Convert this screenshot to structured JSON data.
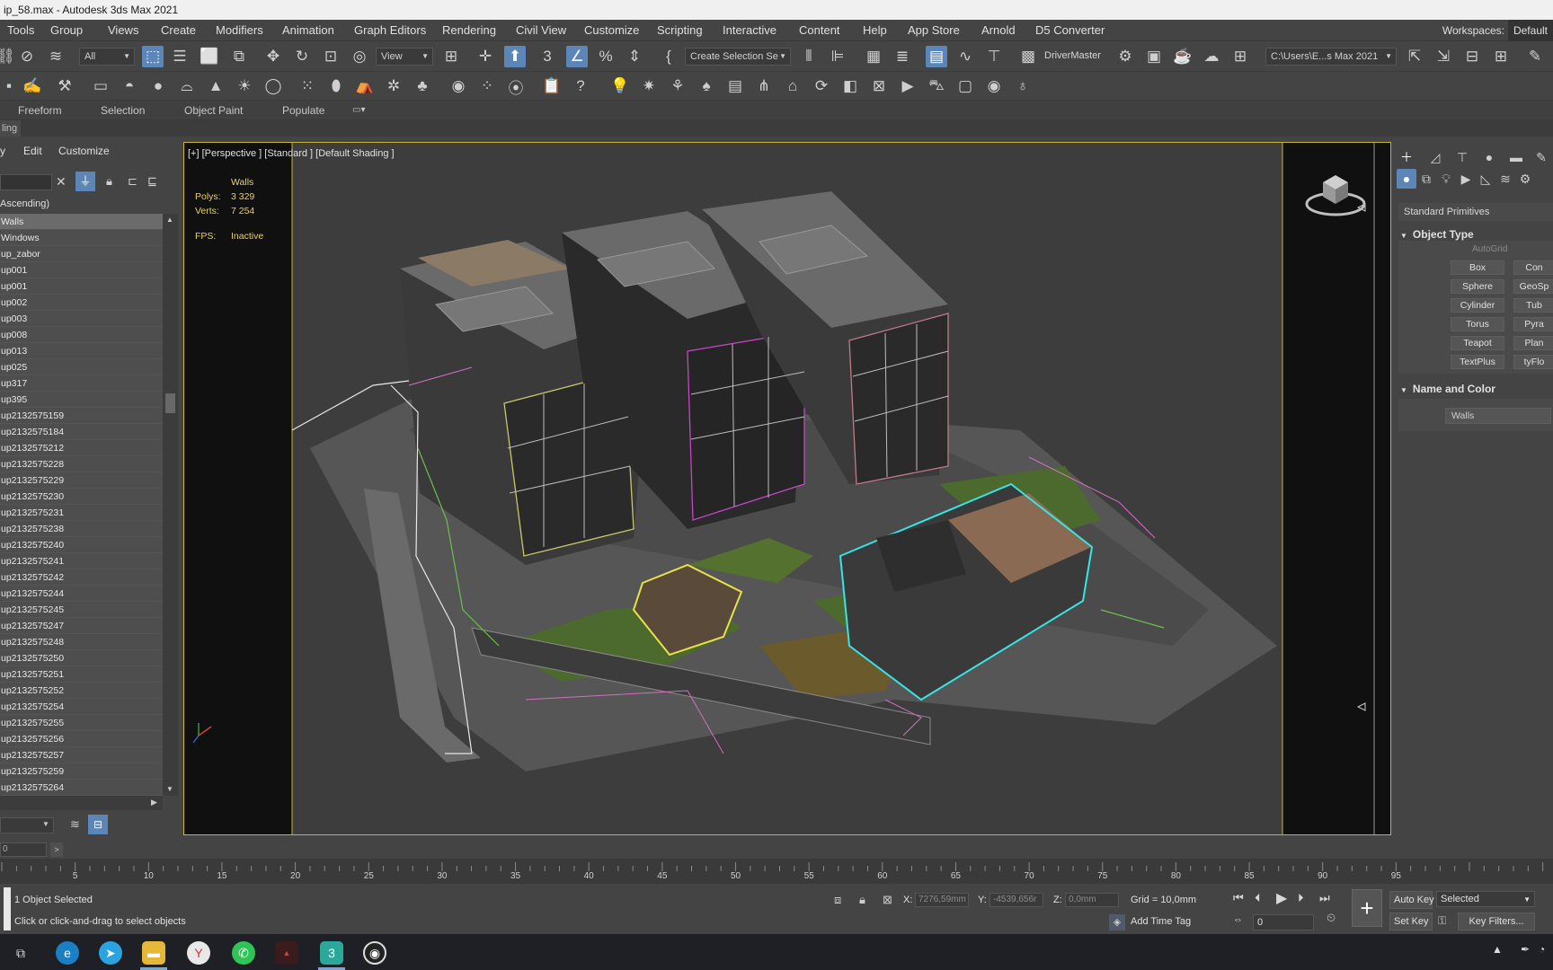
{
  "window": {
    "title": "ip_58.max - Autodesk 3ds Max 2021"
  },
  "menubar": {
    "items": [
      "Tools",
      "Group",
      "Views",
      "Create",
      "Modifiers",
      "Animation",
      "Graph Editors",
      "Rendering",
      "Civil View",
      "Customize",
      "Scripting",
      "Interactive",
      "Content",
      "Help",
      "App Store",
      "Arnold",
      "D5 Converter"
    ],
    "workspaces_label": "Workspaces:",
    "workspaces_value": "Default"
  },
  "toolbar": {
    "filter_value": "All",
    "refcoord_value": "View",
    "named_selection_value": "Create Selection Se",
    "plugin_label": "DriverMaster",
    "project_path": "C:\\Users\\E...s Max 2021"
  },
  "ribbon": {
    "tabs": [
      "Freeform",
      "Selection",
      "Object Paint",
      "Populate"
    ],
    "subtab": "ling"
  },
  "explorer": {
    "menu": [
      "y",
      "Edit",
      "Customize"
    ],
    "sort_label": "Ascending)",
    "rows": [
      "Walls",
      "Windows",
      "up_zabor",
      "up001",
      "up001",
      "up002",
      "up003",
      "up008",
      "up013",
      "up025",
      "up317",
      "up395",
      "up2132575159",
      "up2132575184",
      "up2132575212",
      "up2132575228",
      "up2132575229",
      "up2132575230",
      "up2132575231",
      "up2132575238",
      "up2132575240",
      "up2132575241",
      "up2132575242",
      "up2132575244",
      "up2132575245",
      "up2132575247",
      "up2132575248",
      "up2132575250",
      "up2132575251",
      "up2132575252",
      "up2132575254",
      "up2132575255",
      "up2132575256",
      "up2132575257",
      "up2132575259",
      "up2132575264"
    ],
    "selected_index": 0,
    "bottom_value": "0"
  },
  "viewport": {
    "label": "[+] [Perspective ] [Standard ] [Default Shading ]",
    "selected_name": "Walls",
    "polys_label": "Polys:",
    "polys_value": "3 329",
    "verts_label": "Verts:",
    "verts_value": "7 254",
    "fps_label": "FPS:",
    "fps_value": "Inactive"
  },
  "command_panel": {
    "category": "Standard Primitives",
    "object_type_title": "Object Type",
    "autogrid": "AutoGrid",
    "primitives_left": [
      "Box",
      "Sphere",
      "Cylinder",
      "Torus",
      "Teapot",
      "TextPlus"
    ],
    "primitives_right": [
      "Con",
      "GeoSp",
      "Tub",
      "Pyra",
      "Plan",
      "tyFlo"
    ],
    "name_color_title": "Name and Color",
    "name_value": "Walls"
  },
  "timeline": {
    "ticks": [
      "5",
      "10",
      "15",
      "20",
      "25",
      "30",
      "35",
      "40",
      "45",
      "50",
      "55",
      "60",
      "65",
      "70",
      "75",
      "80",
      "85",
      "90",
      "95"
    ]
  },
  "statusbar": {
    "selection_status": "1 Object Selected",
    "prompt": "Click or click-and-drag to select objects",
    "x_label": "X:",
    "x_value": "7276,59mm",
    "y_label": "Y:",
    "y_value": "-4539,656r",
    "z_label": "Z:",
    "z_value": "0,0mm",
    "grid": "Grid = 10,0mm",
    "add_time_tag": "Add Time Tag",
    "frame_value": "0",
    "auto_key": "Auto Key",
    "set_key": "Set Key",
    "selected_set": "Selected",
    "key_filters": "Key Filters..."
  }
}
